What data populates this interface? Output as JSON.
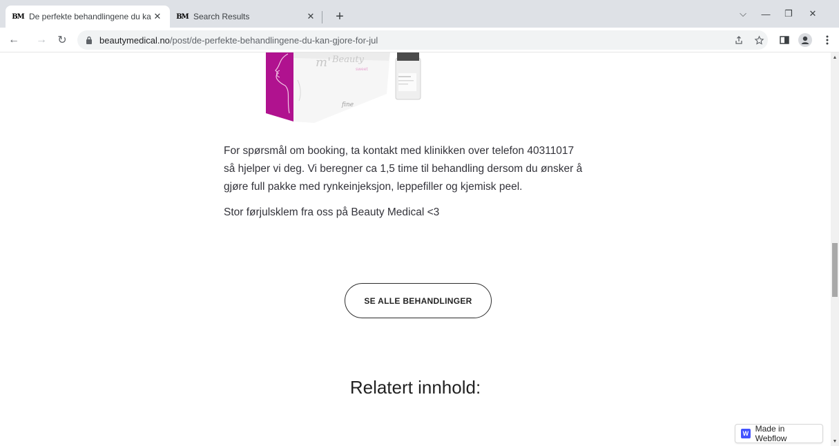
{
  "browser": {
    "tabs": [
      {
        "favicon": "BM",
        "title": "De perfekte behandlingene du ka",
        "close": "✕"
      },
      {
        "favicon": "BM",
        "title": "Search Results",
        "close": "✕"
      }
    ],
    "new_tab": "+",
    "window_controls": {
      "tab_search": "⌵",
      "minimize": "—",
      "restore": "❐",
      "close": "✕"
    },
    "nav": {
      "back": "←",
      "forward": "→",
      "reload": "↻"
    },
    "url_domain": "beautymedical.no",
    "url_path": "/post/de-perfekte-behandlingene-du-kan-gjore-for-jul",
    "toolbar_icons": [
      "share-icon",
      "star-icon",
      "sidepanel-icon",
      "profile-icon",
      "menu-icon"
    ]
  },
  "article": {
    "paragraph1_line1": "For spørsmål om booking, ta kontakt med klinikken over telefon 40311017",
    "paragraph1_line2": "så hjelper vi deg. Vi beregner ca 1,5 time til behandling dersom du ønsker å",
    "paragraph1_line3": "gjøre full pakke med rynkeinjeksjon, leppefiller og kjemisk peel.",
    "paragraph2": "Stor førjulsklem fra oss på Beauty Medical <3"
  },
  "cta_button": "SE ALLE BEHANDLINGER",
  "related_heading": "Relatert innhold:",
  "webflow_badge": {
    "logo": "W",
    "label": "Made in Webflow"
  },
  "colors": {
    "brand_magenta": "#b0128f",
    "webflow_blue": "#4353ff"
  }
}
